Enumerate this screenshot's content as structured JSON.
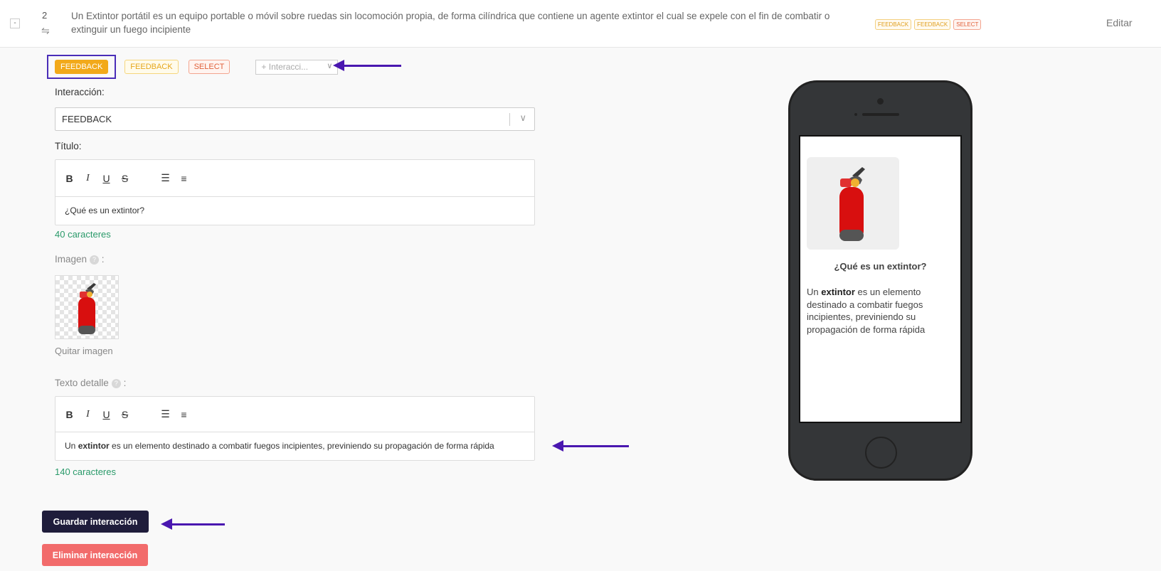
{
  "row": {
    "collapse_label": "-",
    "number": "2",
    "description": "Un Extintor portátil es un equipo portable o móvil sobre ruedas sin locomoción propia, de forma cilíndrica que contiene un agente extintor el cual se expele con el fin de combatir o extinguir un fuego incipiente",
    "tags": [
      "FEEDBACK",
      "FEEDBACK",
      "SELECT"
    ],
    "edit_label": "Editar"
  },
  "tags_bar": {
    "active_tag": "FEEDBACK",
    "tag_2": "FEEDBACK",
    "tag_3": "SELECT",
    "add_interaction_placeholder": "+ Interacci..."
  },
  "form": {
    "interaction_label": "Interacción",
    "interaction_value": "FEEDBACK",
    "title_label": "Título",
    "title_value": "¿Qué es un extintor?",
    "title_counter": "40 caracteres",
    "image_label": "Imagen",
    "remove_image": "Quitar imagen",
    "detail_label": "Texto detalle",
    "detail_before": "Un ",
    "detail_bold": "extintor",
    "detail_after": " es un elemento destinado a combatir fuegos incipientes, previniendo su propagación de forma rápida",
    "detail_counter": "140 caracteres"
  },
  "toolbar": {
    "bold": "B",
    "italic": "I",
    "underline": "U",
    "strike": "S"
  },
  "actions": {
    "save_label": "Guardar interacción",
    "delete_label": "Eliminar interacción"
  },
  "preview": {
    "title": "¿Qué es un extintor?",
    "text_before": "Un ",
    "text_bold": "extintor",
    "text_after": " es un elemento destinado a combatir fuegos incipientes, previniendo su propagación de forma rápida"
  },
  "colors": {
    "accent": "#f2a91a",
    "save_button": "#1f1d3b",
    "delete_button": "#f26b6b",
    "counter": "#2a9a6a",
    "annotation_arrow": "#4a17b0"
  }
}
